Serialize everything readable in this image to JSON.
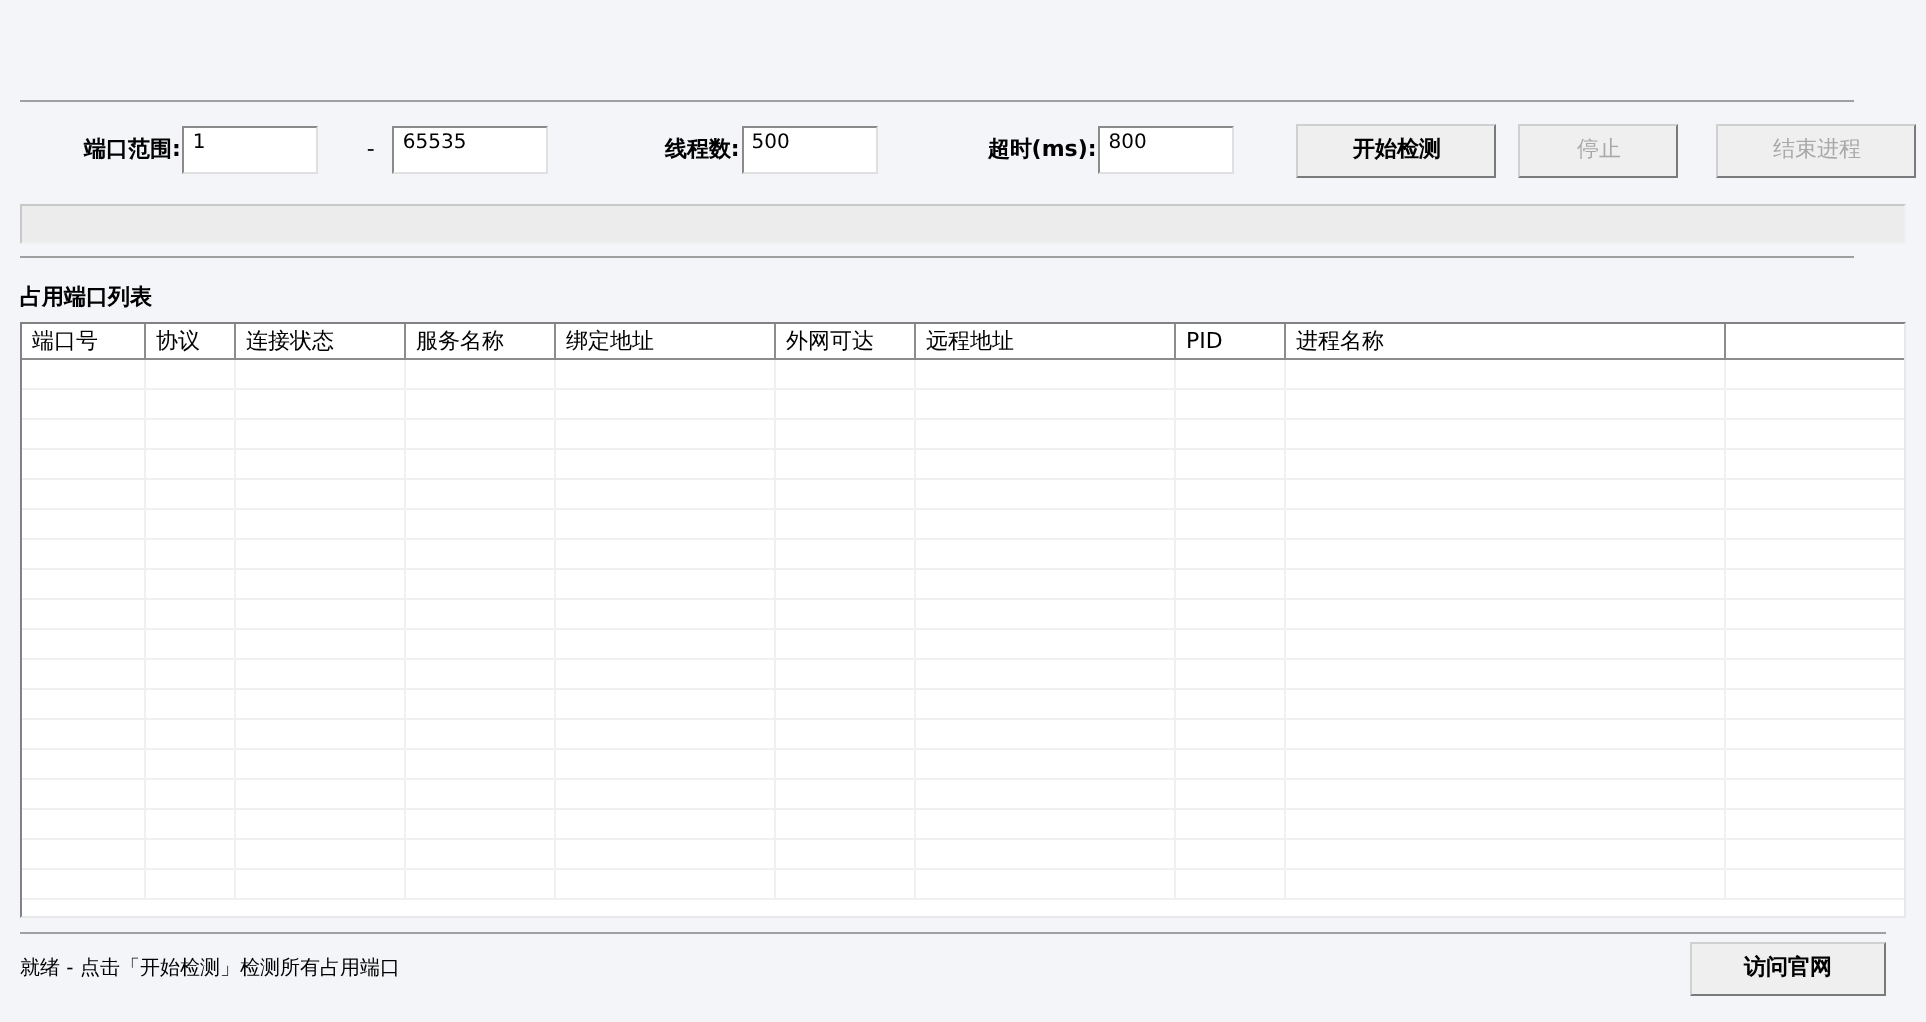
{
  "scan_settings": {
    "port_range_label": "端口范围:",
    "port_from": "1",
    "range_separator": "-",
    "port_to": "65535",
    "threads_label": "线程数:",
    "threads": "500",
    "timeout_label": "超时(ms):",
    "timeout": "800"
  },
  "buttons": [
    {
      "label": "开始检测",
      "disabled": false
    },
    {
      "label": "停止",
      "disabled": true
    },
    {
      "label": "结束进程",
      "disabled": true
    }
  ],
  "progress": {
    "level": 0
  },
  "table": {
    "title": "占用端口列表",
    "columns": [
      "端口号",
      "协议",
      "连接状态",
      "服务名称",
      "绑定地址",
      "外网可达",
      "远程地址",
      "PID",
      "进程名称"
    ]
  },
  "status_bar": {
    "text": "就绪 - 点击「开始检测」检测所有占用端口",
    "button": "访问官网"
  }
}
